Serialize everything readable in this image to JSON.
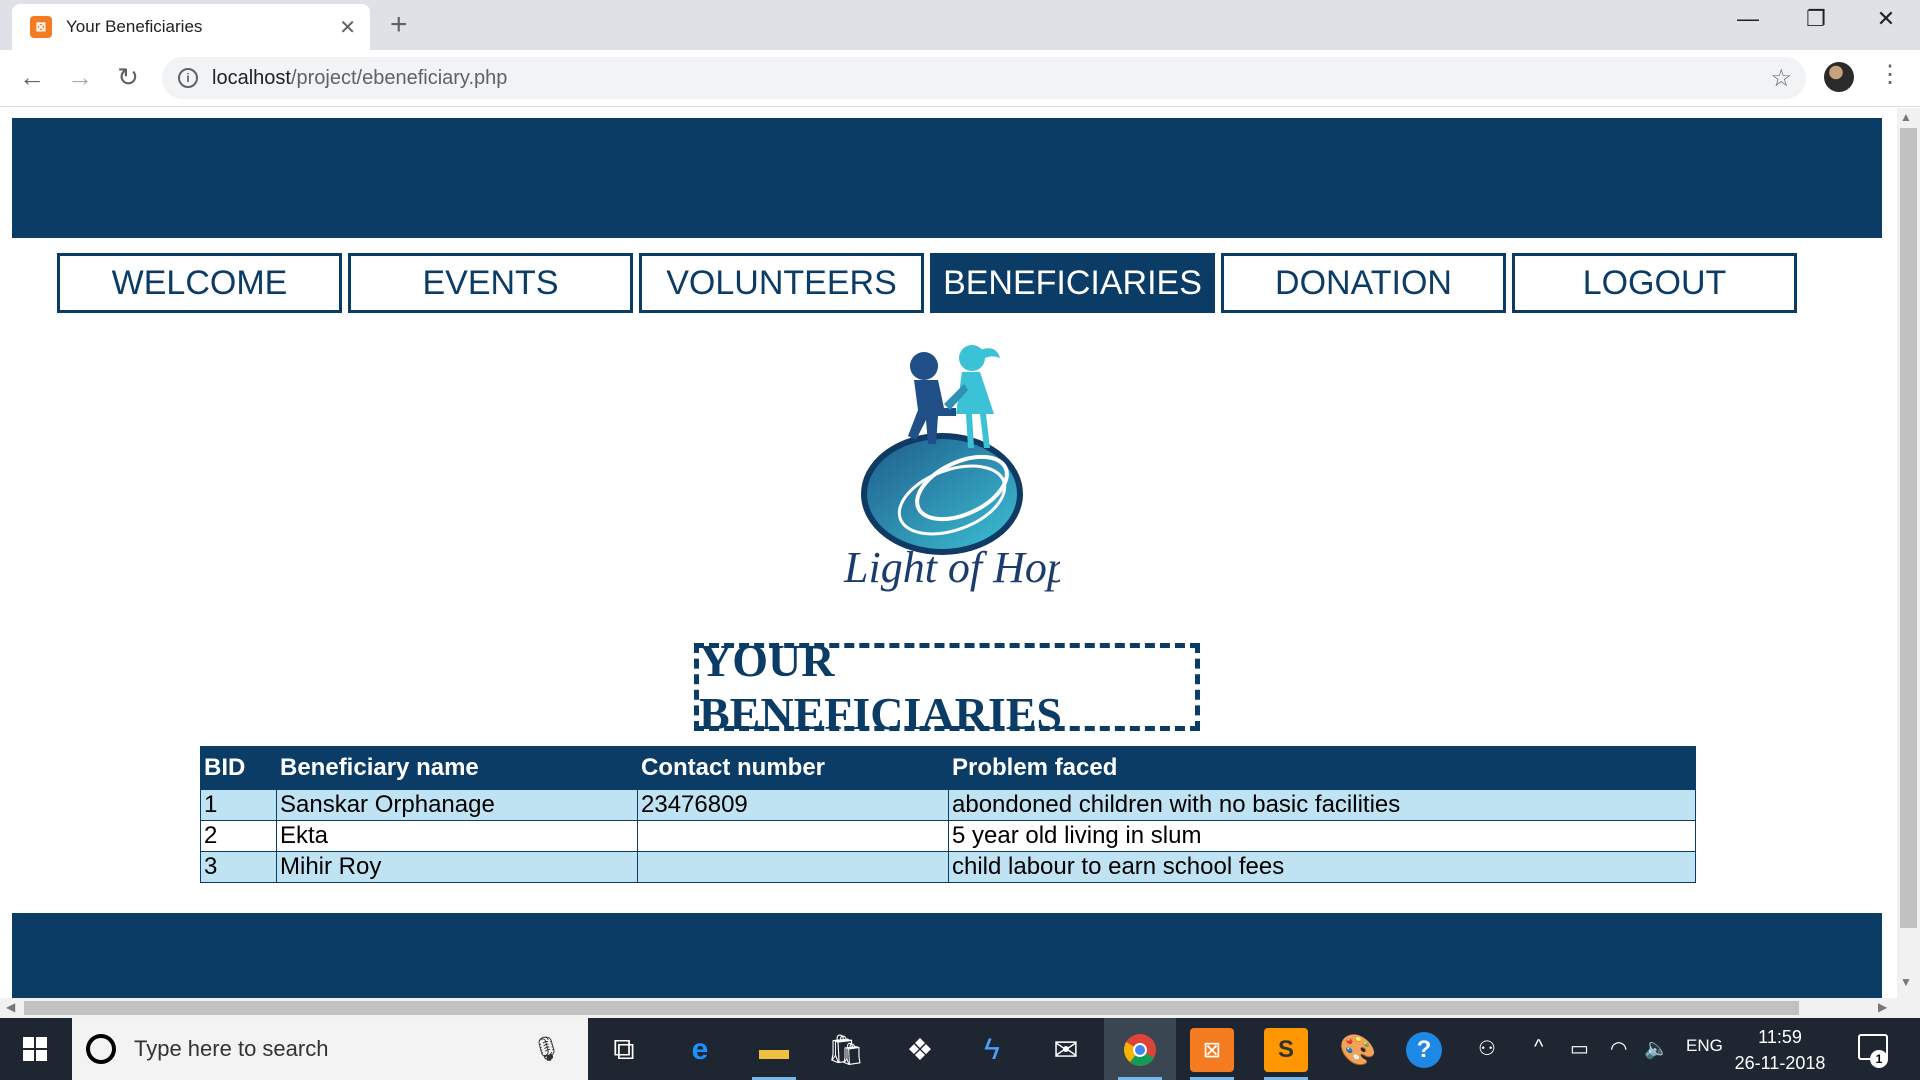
{
  "browser": {
    "tab_title": "Your Beneficiaries",
    "tab_favicon": "xampp-icon",
    "url_host": "localhost",
    "url_path": "/project/ebeneficiary.php"
  },
  "nav": {
    "items": [
      {
        "label": "WELCOME",
        "active": false
      },
      {
        "label": "EVENTS",
        "active": false
      },
      {
        "label": "VOLUNTEERS",
        "active": false
      },
      {
        "label": "BENEFICIARIES",
        "active": true
      },
      {
        "label": "DONATION",
        "active": false
      },
      {
        "label": "LOGOUT",
        "active": false
      }
    ]
  },
  "logo": {
    "text": "Light of Hope"
  },
  "page_title": "YOUR BENEFICIARIES",
  "table": {
    "headers": [
      "BID",
      "Beneficiary name",
      "Contact number",
      "Problem faced"
    ],
    "rows": [
      [
        "1",
        "Sanskar Orphanage",
        "23476809",
        "abondoned children with no basic facilities"
      ],
      [
        "2",
        "Ekta",
        "",
        "5 year old living in slum"
      ],
      [
        "3",
        "Mihir Roy",
        "",
        "child labour to earn school fees"
      ]
    ]
  },
  "colors": {
    "primary": "#0b3c66",
    "row_alt": "#bfe3f3"
  },
  "taskbar": {
    "search_placeholder": "Type here to search",
    "language": "ENG",
    "time": "11:59",
    "date": "26-11-2018",
    "notification_count": "1"
  }
}
